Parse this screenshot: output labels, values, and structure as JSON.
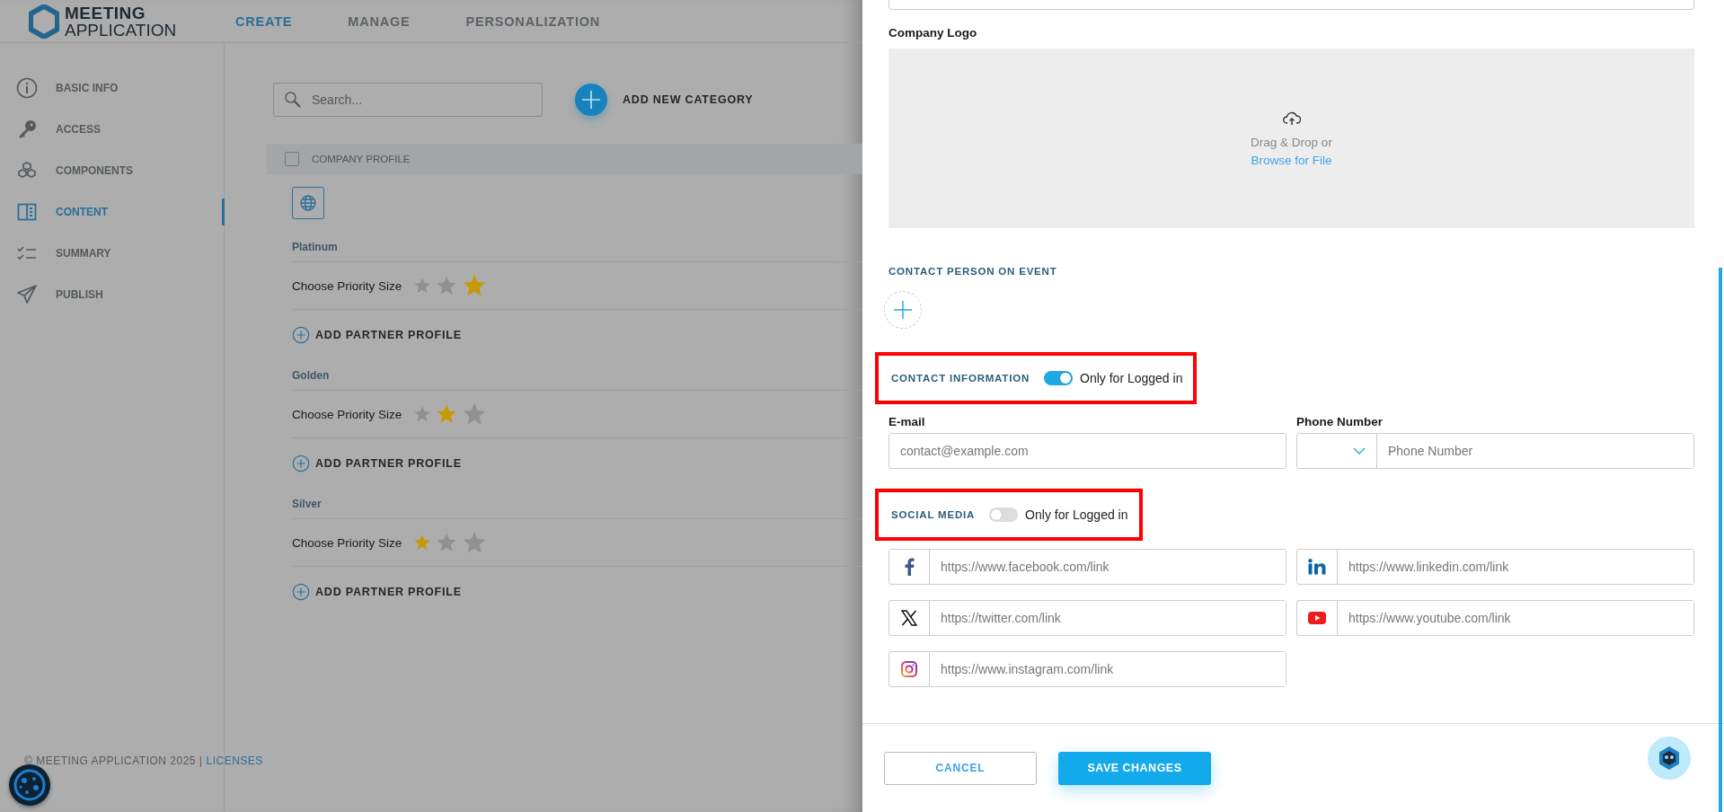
{
  "header": {
    "logo": [
      "MEETING",
      "APPLICATION"
    ],
    "nav": [
      {
        "label": "CREATE",
        "selected": true
      },
      {
        "label": "MANAGE",
        "selected": false
      },
      {
        "label": "PERSONALIZATION",
        "selected": false
      }
    ]
  },
  "sidebar": {
    "items": [
      {
        "kind": "info",
        "label": "BASIC INFO",
        "selected": false
      },
      {
        "kind": "key",
        "label": "ACCESS",
        "selected": false
      },
      {
        "kind": "cubes",
        "label": "COMPONENTS",
        "selected": false
      },
      {
        "kind": "content",
        "label": "CONTENT",
        "selected": true
      },
      {
        "kind": "checklist",
        "label": "SUMMARY",
        "selected": false
      },
      {
        "kind": "send",
        "label": "PUBLISH",
        "selected": false
      }
    ]
  },
  "footer": {
    "copyright": "© MEETING APPLICATION 2025 |",
    "link": "LICENSES"
  },
  "toolbar": {
    "search": {
      "placeholder": "Search..."
    },
    "add_button": "ADD NEW CATEGORY"
  },
  "table": {
    "header": "COMPANY PROFILE",
    "checked": false
  },
  "categories": [
    {
      "name": "Platinum",
      "label": "Choose Priority Size",
      "sizes": [
        {
          "selected": false
        },
        {
          "selected": false
        },
        {
          "selected": true
        }
      ],
      "add": "ADD PARTNER PROFILE"
    },
    {
      "name": "Golden",
      "label": "Choose Priority Size",
      "sizes": [
        {
          "selected": false
        },
        {
          "selected": true
        },
        {
          "selected": false
        }
      ],
      "add": "ADD PARTNER PROFILE"
    },
    {
      "name": "Silver",
      "label": "Choose Priority Size",
      "sizes": [
        {
          "selected": true
        },
        {
          "selected": false
        },
        {
          "selected": false
        }
      ],
      "add": "ADD PARTNER PROFILE"
    }
  ],
  "panel": {
    "logo": {
      "label": "Company Logo",
      "drop_text": "Drag & Drop or",
      "browse": "Browse for File"
    },
    "contact_person": {
      "title": "CONTACT PERSON ON EVENT"
    },
    "contact_information": {
      "title": "CONTACT INFORMATION",
      "toggle_label": "Only for Logged in",
      "on": true,
      "highlighted": true
    },
    "email": {
      "label": "E-mail",
      "placeholder": "contact@example.com"
    },
    "phone": {
      "label": "Phone Number",
      "placeholder": "Phone Number"
    },
    "social_media": {
      "title": "SOCIAL MEDIA",
      "toggle_label": "Only for Logged in",
      "on": false,
      "highlighted": true
    },
    "social_links": [
      {
        "kind": "facebook",
        "placeholder": "https://www.facebook.com/link"
      },
      {
        "kind": "linkedin",
        "placeholder": "https://www.linkedin.com/link"
      },
      {
        "kind": "x",
        "placeholder": "https://twitter.com/link"
      },
      {
        "kind": "youtube",
        "placeholder": "https://www.youtube.com/link"
      },
      {
        "kind": "instagram",
        "placeholder": "https://www.instagram.com/link"
      }
    ],
    "buttons": {
      "cancel": "CANCEL",
      "save": "SAVE CHANGES"
    }
  }
}
